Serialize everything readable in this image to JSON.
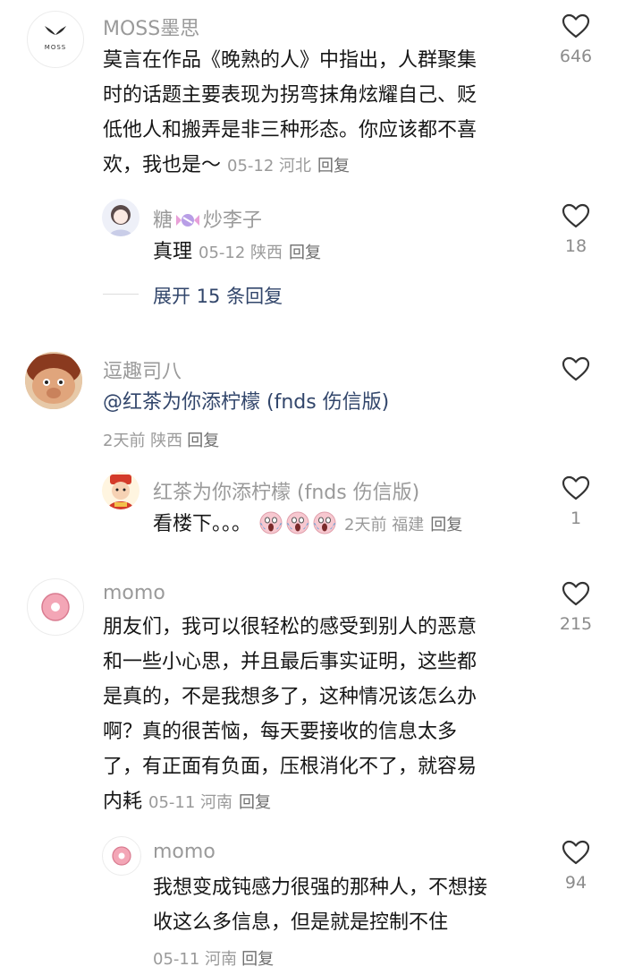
{
  "comments": [
    {
      "user": "MOSS墨思",
      "avatar_text": "MOSS",
      "text_lines": [
        "莫言在作品《晚熟的人》中指出，人群聚集",
        "时的话题主要表现为拐弯抹角炫耀自己、贬",
        "低他人和搬弄是非三种形态。你应该都不喜",
        "欢，我也是～"
      ],
      "meta": "05-12 河北",
      "reply_label": "回复",
      "likes": "646",
      "replies": [
        {
          "user": "糖",
          "user_suffix": "炒李子",
          "text": "真理",
          "meta": "05-12 陕西",
          "reply_label": "回复",
          "likes": "18"
        }
      ],
      "expand_label": "展开 15 条回复"
    },
    {
      "user": "逗趣司八",
      "text": "@红茶为你添柠檬 (fnds 伤信版)",
      "meta": "2天前 陕西",
      "reply_label": "回复",
      "replies": [
        {
          "user": "红茶为你添柠檬 (fnds 伤信版)",
          "text": "看楼下。。。",
          "emoji_name": "scream-emoji",
          "meta": "2天前 福建",
          "reply_label": "回复",
          "likes": "1"
        }
      ]
    },
    {
      "user": "momo",
      "text_lines": [
        "朋友们，我可以很轻松的感受到别人的恶意",
        "和一些小心思，并且最后事实证明，这些都",
        "是真的，不是我想多了，这种情况该怎么办",
        "啊？真的很苦恼，每天要接收的信息太多",
        "了，有正面有负面，压根消化不了，就容易",
        "内耗"
      ],
      "meta": "05-11 河南",
      "reply_label": "回复",
      "likes": "215",
      "replies": [
        {
          "user": "momo",
          "text_lines": [
            "我想变成钝感力很强的那种人，不想接",
            "收这么多信息，但是就是控制不住"
          ],
          "meta": "05-11 河南",
          "reply_label": "回复",
          "likes": "94"
        }
      ]
    }
  ]
}
